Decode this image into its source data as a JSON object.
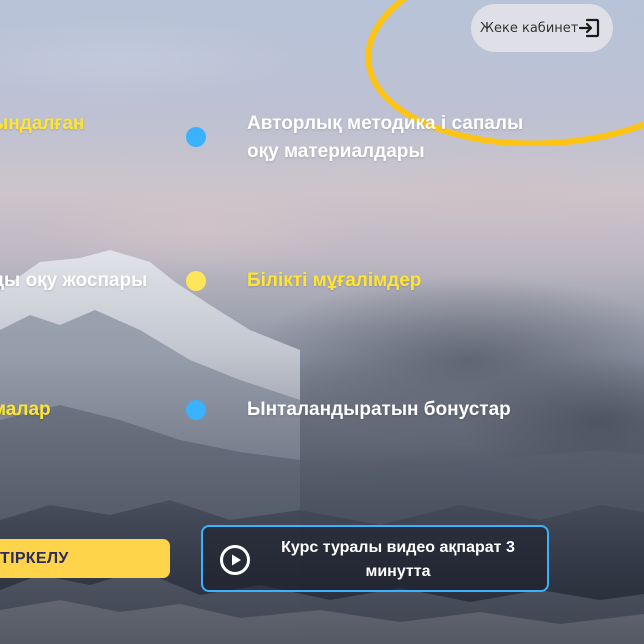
{
  "header": {
    "cabinet_label": "Жеке кабинет",
    "cabinet_icon": "login-icon"
  },
  "features": {
    "left": [
      {
        "label": "ындалған",
        "color": "yellow"
      },
      {
        "label": "ды оқу жоспары",
        "color": "white"
      },
      {
        "label": "малар",
        "color": "yellow"
      }
    ],
    "right": [
      {
        "line1": "Авторлық методика і сапалы",
        "line2": "оқу материалдары",
        "color": "white",
        "dot": "blue"
      },
      {
        "line1": "Білікті мұғалімдер",
        "color": "yellow",
        "dot": "yellow"
      },
      {
        "line1": "Ынталандыратын бонустар",
        "color": "white",
        "dot": "blue"
      }
    ]
  },
  "actions": {
    "register_label": "ТІРКЕЛУ",
    "video_label": "Курс туралы видео ақпарат 3 минутта",
    "video_icon": "play-circle-icon"
  },
  "colors": {
    "accent_yellow": "#ffe531",
    "accent_blue": "#3ab2ff",
    "button_yellow": "#fed54a",
    "button_text": "#2b2c5c",
    "annotation_ring": "#fdc414"
  }
}
